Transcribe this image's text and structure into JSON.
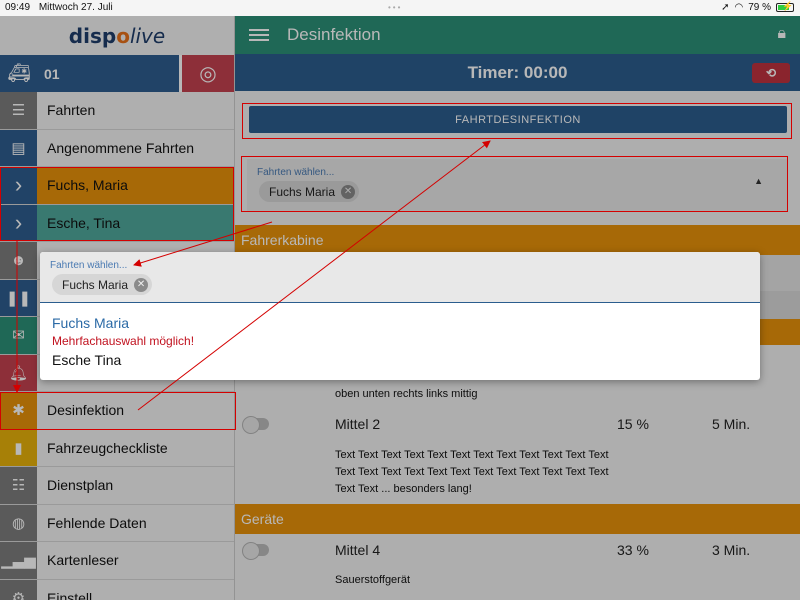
{
  "status": {
    "time": "09:49",
    "date": "Mittwoch 27. Juli",
    "battery": "79 %",
    "battery_level": 0.79
  },
  "sidebar": {
    "logo": {
      "part1": "disp",
      "part2": "o",
      "part3": "live"
    },
    "vehicle_number": "01",
    "items": [
      {
        "label": "Fahrten",
        "icon": "list-icon",
        "color": "#7d7d7d"
      },
      {
        "label": "Angenommene Fahrten",
        "icon": "id-card-icon",
        "color": "#2f5d8f"
      },
      {
        "label": "Fuchs, Maria",
        "icon": "chevron-right-icon",
        "color": "#2f5d8f"
      },
      {
        "label": "Esche, Tina",
        "icon": "chevron-right-icon",
        "color": "#2f5d8f"
      },
      {
        "label": "",
        "icon": "users-icon",
        "color": "#7d7d7d"
      },
      {
        "label": "",
        "icon": "pause-icon",
        "color": "#2f5d8f"
      },
      {
        "label": "",
        "icon": "envelope-icon",
        "color": "#2b9078"
      },
      {
        "label": "",
        "icon": "bell-icon",
        "color": "#c4424f"
      },
      {
        "label": "Desinfektion",
        "icon": "bug-icon",
        "color": "#e8920a"
      },
      {
        "label": "Fahrzeugcheckliste",
        "icon": "book-icon",
        "color": "#e8b20a"
      },
      {
        "label": "Dienstplan",
        "icon": "list-alt-icon",
        "color": "#7d7d7d"
      },
      {
        "label": "Fehlende Daten",
        "icon": "database-icon",
        "color": "#7d7d7d"
      },
      {
        "label": "Kartenleser",
        "icon": "signal-icon",
        "color": "#7d7d7d"
      },
      {
        "label": "Einstell",
        "icon": "gear-icon",
        "color": "#7d7d7d"
      }
    ]
  },
  "header": {
    "title": "Desinfektion"
  },
  "timer": {
    "label": "Timer: 00:00"
  },
  "main": {
    "button_label": "FAHRTDESINFEKTION",
    "select": {
      "hint": "Fahrten wählen...",
      "chip": "Fuchs Maria"
    },
    "sections": [
      {
        "title": "Fahrerkabine"
      },
      {
        "title": "Geräte"
      }
    ],
    "desc1": "oben unten rechts links mittig",
    "row1": {
      "name": "Mittel 2",
      "pct": "15 %",
      "time": "5 Min."
    },
    "desc2": "Text Text Text Text Text Text Text Text Text Text Text Text Text Text Text Text Text Text Text Text Text Text Text Text Text Text ... besonders lang!",
    "row2": {
      "name": "Mittel 4",
      "pct": "33 %",
      "time": "3 Min."
    },
    "desc3": "Sauerstoffgerät"
  },
  "popup": {
    "hint": "Fahrten wählen...",
    "chip": "Fuchs Maria",
    "options": [
      "Fuchs Maria",
      "Esche Tina"
    ],
    "note": "Mehrfachauswahl möglich!"
  }
}
